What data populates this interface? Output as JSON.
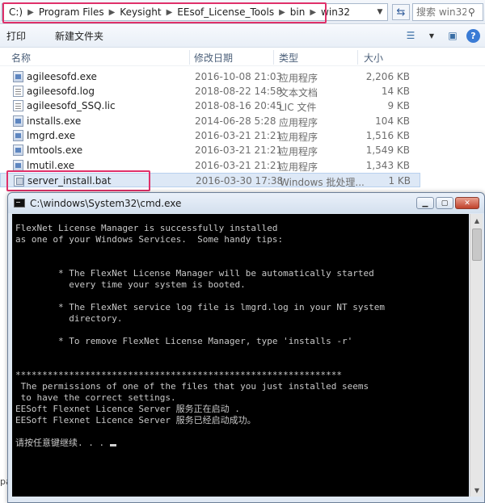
{
  "address": {
    "segments": [
      "C:)",
      "Program Files",
      "Keysight",
      "EEsof_License_Tools",
      "bin",
      "win32"
    ],
    "search_placeholder": "搜索 win32"
  },
  "toolbar": {
    "open_label": "打印",
    "new_folder_label": "新建文件夹"
  },
  "columns": {
    "name": "名称",
    "date": "修改日期",
    "type": "类型",
    "size": "大小"
  },
  "files": [
    {
      "name": "agileesofd.exe",
      "date": "2016-10-08 21:03",
      "type": "应用程序",
      "size": "2,206 KB",
      "icon": "exe"
    },
    {
      "name": "agileesofd.log",
      "date": "2018-08-22 14:58",
      "type": "文本文档",
      "size": "14 KB",
      "icon": "txt"
    },
    {
      "name": "agileesofd_SSQ.lic",
      "date": "2018-08-16 20:45",
      "type": "LIC 文件",
      "size": "9 KB",
      "icon": "txt"
    },
    {
      "name": "installs.exe",
      "date": "2014-06-28 5:28",
      "type": "应用程序",
      "size": "104 KB",
      "icon": "exe"
    },
    {
      "name": "lmgrd.exe",
      "date": "2016-03-21 21:21",
      "type": "应用程序",
      "size": "1,516 KB",
      "icon": "exe"
    },
    {
      "name": "lmtools.exe",
      "date": "2016-03-21 21:21",
      "type": "应用程序",
      "size": "1,549 KB",
      "icon": "exe"
    },
    {
      "name": "lmutil.exe",
      "date": "2016-03-21 21:21",
      "type": "应用程序",
      "size": "1,343 KB",
      "icon": "exe"
    },
    {
      "name": "server_install.bat",
      "date": "2016-03-30 17:38",
      "type": "Windows 批处理...",
      "size": "1 KB",
      "icon": "bat"
    }
  ],
  "side_fragment": "pa",
  "cmd": {
    "title": "C:\\windows\\System32\\cmd.exe",
    "lines": [
      "FlexNet License Manager is successfully installed",
      "as one of your Windows Services.  Some handy tips:",
      "",
      "",
      "        * The FlexNet License Manager will be automatically started",
      "          every time your system is booted.",
      "",
      "        * The FlexNet service log file is lmgrd.log in your NT system",
      "          directory.",
      "",
      "        * To remove FlexNet License Manager, type 'installs -r'",
      "",
      "",
      "*************************************************************",
      " The permissions of one of the files that you just installed seems",
      " to have the correct settings.",
      "EESoft Flexnet Licence Server 服务正在启动 .",
      "EESoft Flexnet Licence Server 服务已经启动成功。",
      "",
      "请按任意键继续. . . "
    ]
  }
}
